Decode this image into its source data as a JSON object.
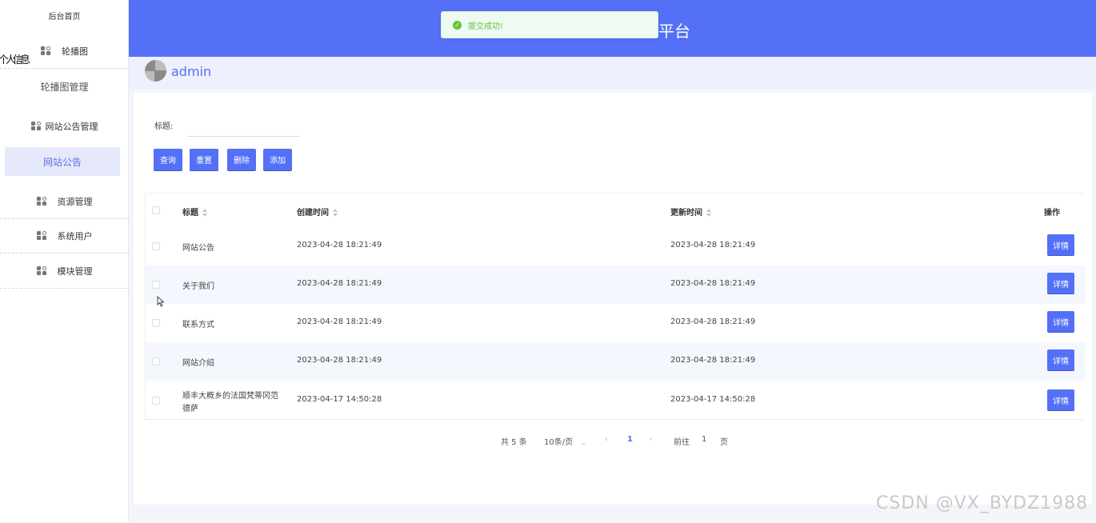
{
  "sidebar": {
    "home": "后台首页",
    "overlap_text": "个人信息",
    "carousel": "轮播图",
    "carousel_manage": "轮播图管理",
    "notice_manage": "网站公告管理",
    "notice": "网站公告",
    "resource": "资源管理",
    "users": "系统用户",
    "modules": "模块管理"
  },
  "header": {
    "title": "平台",
    "toast": "提交成功!",
    "accent": "#5470f6"
  },
  "user": {
    "name": "admin"
  },
  "filter": {
    "label": "标题:",
    "value": "",
    "placeholder": ""
  },
  "buttons": {
    "query": "查询",
    "reset": "重置",
    "delete": "删除",
    "add": "添加"
  },
  "table": {
    "columns": [
      "标题",
      "创建时间",
      "更新时间",
      "操作"
    ],
    "action_label": "详情",
    "rows": [
      {
        "title": "网站公告",
        "created": "2023-04-28 18:21:49",
        "updated": "2023-04-28 18:21:49"
      },
      {
        "title": "关于我们",
        "created": "2023-04-28 18:21:49",
        "updated": "2023-04-28 18:21:49"
      },
      {
        "title": "联系方式",
        "created": "2023-04-28 18:21:49",
        "updated": "2023-04-28 18:21:49"
      },
      {
        "title": "网站介绍",
        "created": "2023-04-28 18:21:49",
        "updated": "2023-04-28 18:21:49"
      },
      {
        "title_line1": "顺丰大概乡的法国梵蒂冈范",
        "title_line2": "德萨",
        "created": "2023-04-17 14:50:28",
        "updated": "2023-04-17 14:50:28"
      }
    ]
  },
  "pagination": {
    "total": "共 5 条",
    "page_size": "10条/页",
    "current": "1",
    "goto_label": "前往",
    "goto_value": "1",
    "page_suffix": "页"
  },
  "watermark": "CSDN @VX_BYDZ1988"
}
